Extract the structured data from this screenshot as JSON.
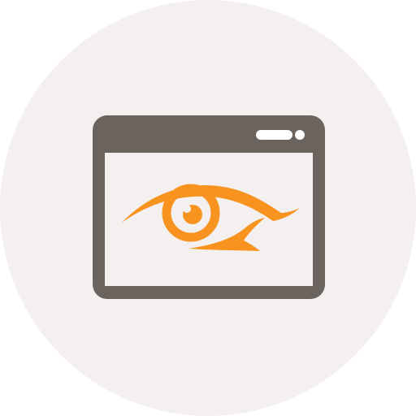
{
  "icon": {
    "name": "browser-window-eye-icon",
    "parts": [
      "circle-background",
      "browser-window",
      "eye"
    ]
  },
  "colors": {
    "background_circle": "#F3F0EF",
    "window_frame": "#6B635D",
    "window_content": "#F3F0EF",
    "window_controls": "#FFFFFF",
    "eye": "#F7931E"
  }
}
